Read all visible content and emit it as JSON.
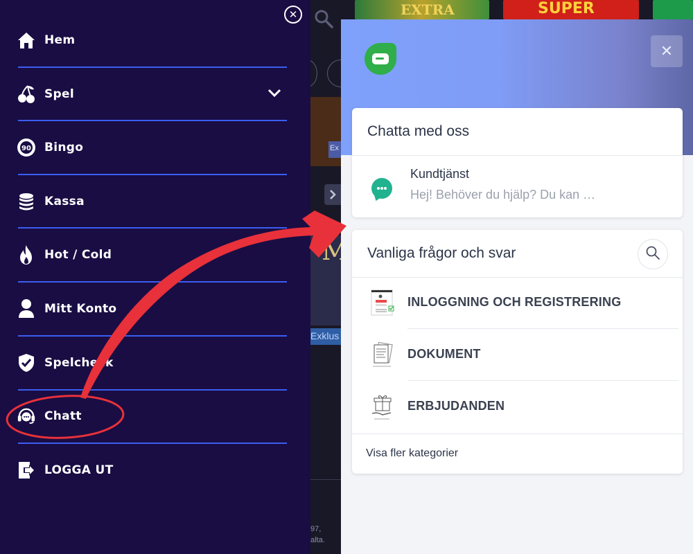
{
  "menu": {
    "items": [
      {
        "label": "Hem",
        "icon": "home-icon"
      },
      {
        "label": "Spel",
        "icon": "cherry-icon"
      },
      {
        "label": "Bingo",
        "icon": "bingo-ball-icon"
      },
      {
        "label": "Kassa",
        "icon": "coins-icon"
      },
      {
        "label": "Hot / Cold",
        "icon": "flame-icon"
      },
      {
        "label": "Mitt Konto",
        "icon": "user-icon"
      },
      {
        "label": "Spelcheck",
        "icon": "shield-check-icon"
      },
      {
        "label": "Chatt",
        "icon": "headset-icon"
      },
      {
        "label": "LOGGA UT",
        "icon": "logout-icon"
      }
    ]
  },
  "background": {
    "game_tiles": [
      "EXTRA",
      "SUPER"
    ],
    "labels": [
      "Ex",
      "Exklus",
      "M"
    ],
    "footer_text": [
      "97,",
      "alta."
    ]
  },
  "chat": {
    "title": "Chatta med oss",
    "conversation": {
      "name": "Kundtjänst",
      "preview": "Hej! Behöver du hjälp? Du kan …"
    }
  },
  "faq": {
    "title": "Vanliga frågor och svar",
    "categories": [
      {
        "label": "INLOGGNING OCH REGISTRERING"
      },
      {
        "label": "DOKUMENT"
      },
      {
        "label": "ERBJUDANDEN"
      }
    ],
    "more_label": "Visa fler kategorier"
  },
  "colors": {
    "menu_bg": "#1a0d43",
    "divider": "#3a5ef0",
    "accent_green": "#2fae4a",
    "chat_icon": "#21b28f",
    "annotation_red": "#e8313a"
  }
}
